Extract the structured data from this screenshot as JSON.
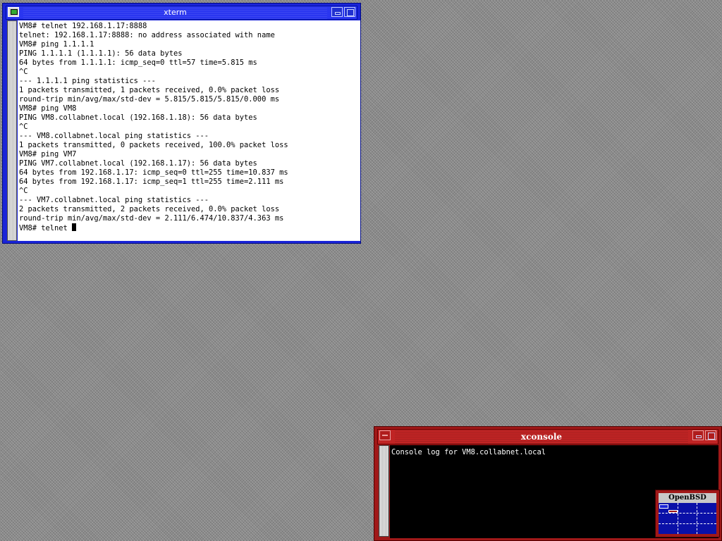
{
  "xterm": {
    "title": "xterm",
    "lines": [
      "VM8# telnet 192.168.1.17:8888",
      "telnet: 192.168.1.17:8888: no address associated with name",
      "VM8# ping 1.1.1.1",
      "PING 1.1.1.1 (1.1.1.1): 56 data bytes",
      "64 bytes from 1.1.1.1: icmp_seq=0 ttl=57 time=5.815 ms",
      "^C",
      "--- 1.1.1.1 ping statistics ---",
      "1 packets transmitted, 1 packets received, 0.0% packet loss",
      "round-trip min/avg/max/std-dev = 5.815/5.815/5.815/0.000 ms",
      "VM8# ping VM8",
      "PING VM8.collabnet.local (192.168.1.18): 56 data bytes",
      "^C",
      "--- VM8.collabnet.local ping statistics ---",
      "1 packets transmitted, 0 packets received, 100.0% packet loss",
      "VM8# ping VM7",
      "PING VM7.collabnet.local (192.168.1.17): 56 data bytes",
      "64 bytes from 192.168.1.17: icmp_seq=0 ttl=255 time=10.837 ms",
      "64 bytes from 192.168.1.17: icmp_seq=1 ttl=255 time=2.111 ms",
      "^C",
      "--- VM7.collabnet.local ping statistics ---",
      "2 packets transmitted, 2 packets received, 0.0% packet loss",
      "round-trip min/avg/max/std-dev = 2.111/6.474/10.837/4.363 ms"
    ],
    "current_input": "VM8# telnet "
  },
  "xconsole": {
    "title": "xconsole",
    "log_text": "Console log for VM8.collabnet.local"
  },
  "pager": {
    "title": "OpenBSD"
  },
  "colors": {
    "xterm_frame": "#1a24d8",
    "xconsole_frame": "#a01818",
    "desktop": "#8a8a8a",
    "pager_desk": "#0a10a8"
  },
  "icons": {
    "xterm_menu": "terminal-icon",
    "minimize": "minimize-icon",
    "maximize": "maximize-icon"
  }
}
